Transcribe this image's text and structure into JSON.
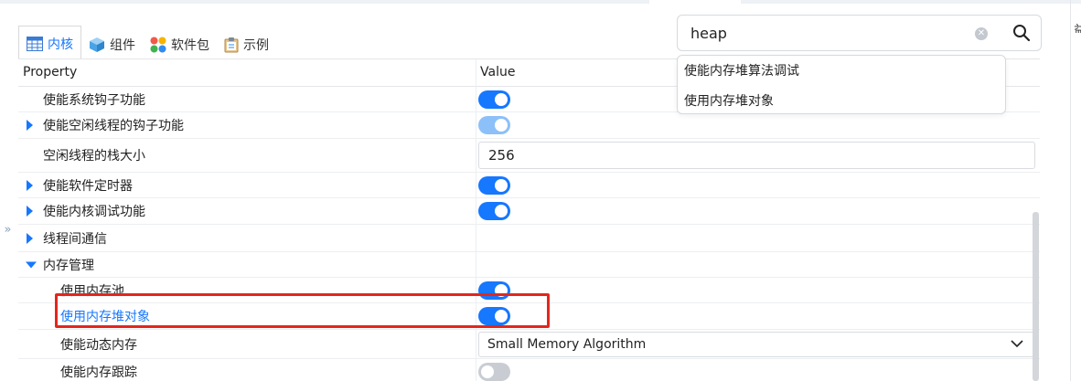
{
  "tabs": [
    {
      "label": "内核",
      "icon": "table-icon",
      "active": true
    },
    {
      "label": "组件",
      "icon": "cube-icon",
      "active": false
    },
    {
      "label": "软件包",
      "icon": "apps-icon",
      "active": false
    },
    {
      "label": "示例",
      "icon": "clipboard-icon",
      "active": false
    }
  ],
  "search": {
    "value": "heap"
  },
  "suggestions": [
    "使能内存堆算法调试",
    "使用内存堆对象"
  ],
  "table": {
    "header": {
      "property": "Property",
      "value": "Value"
    },
    "rows": [
      {
        "label": "使能系统钩子功能",
        "control": "switch",
        "state": "on"
      },
      {
        "label": "使能空闲线程的钩子功能",
        "control": "switch",
        "state": "on-disabled",
        "expandable": true
      },
      {
        "label": "空闲线程的栈大小",
        "control": "number",
        "value": "256"
      },
      {
        "label": "使能软件定时器",
        "control": "switch",
        "state": "on",
        "expandable": true
      },
      {
        "label": "使能内核调试功能",
        "control": "switch",
        "state": "on",
        "expandable": true
      },
      {
        "label": "线程间通信",
        "control": "none",
        "expandable": true
      },
      {
        "label": "内存管理",
        "control": "none",
        "expanded": true
      },
      {
        "label": "使用内存池",
        "control": "switch",
        "state": "on"
      },
      {
        "label": "使用内存堆对象",
        "control": "switch",
        "state": "on",
        "highlighted": true
      },
      {
        "label": "使能动态内存",
        "control": "select",
        "value": "Small Memory Algorithm"
      },
      {
        "label": "使能内存跟踪",
        "control": "switch",
        "state": "off"
      }
    ]
  },
  "colors": {
    "accent": "#1677ff",
    "highlight_box": "#e3261d"
  },
  "right_edge_char": "益"
}
